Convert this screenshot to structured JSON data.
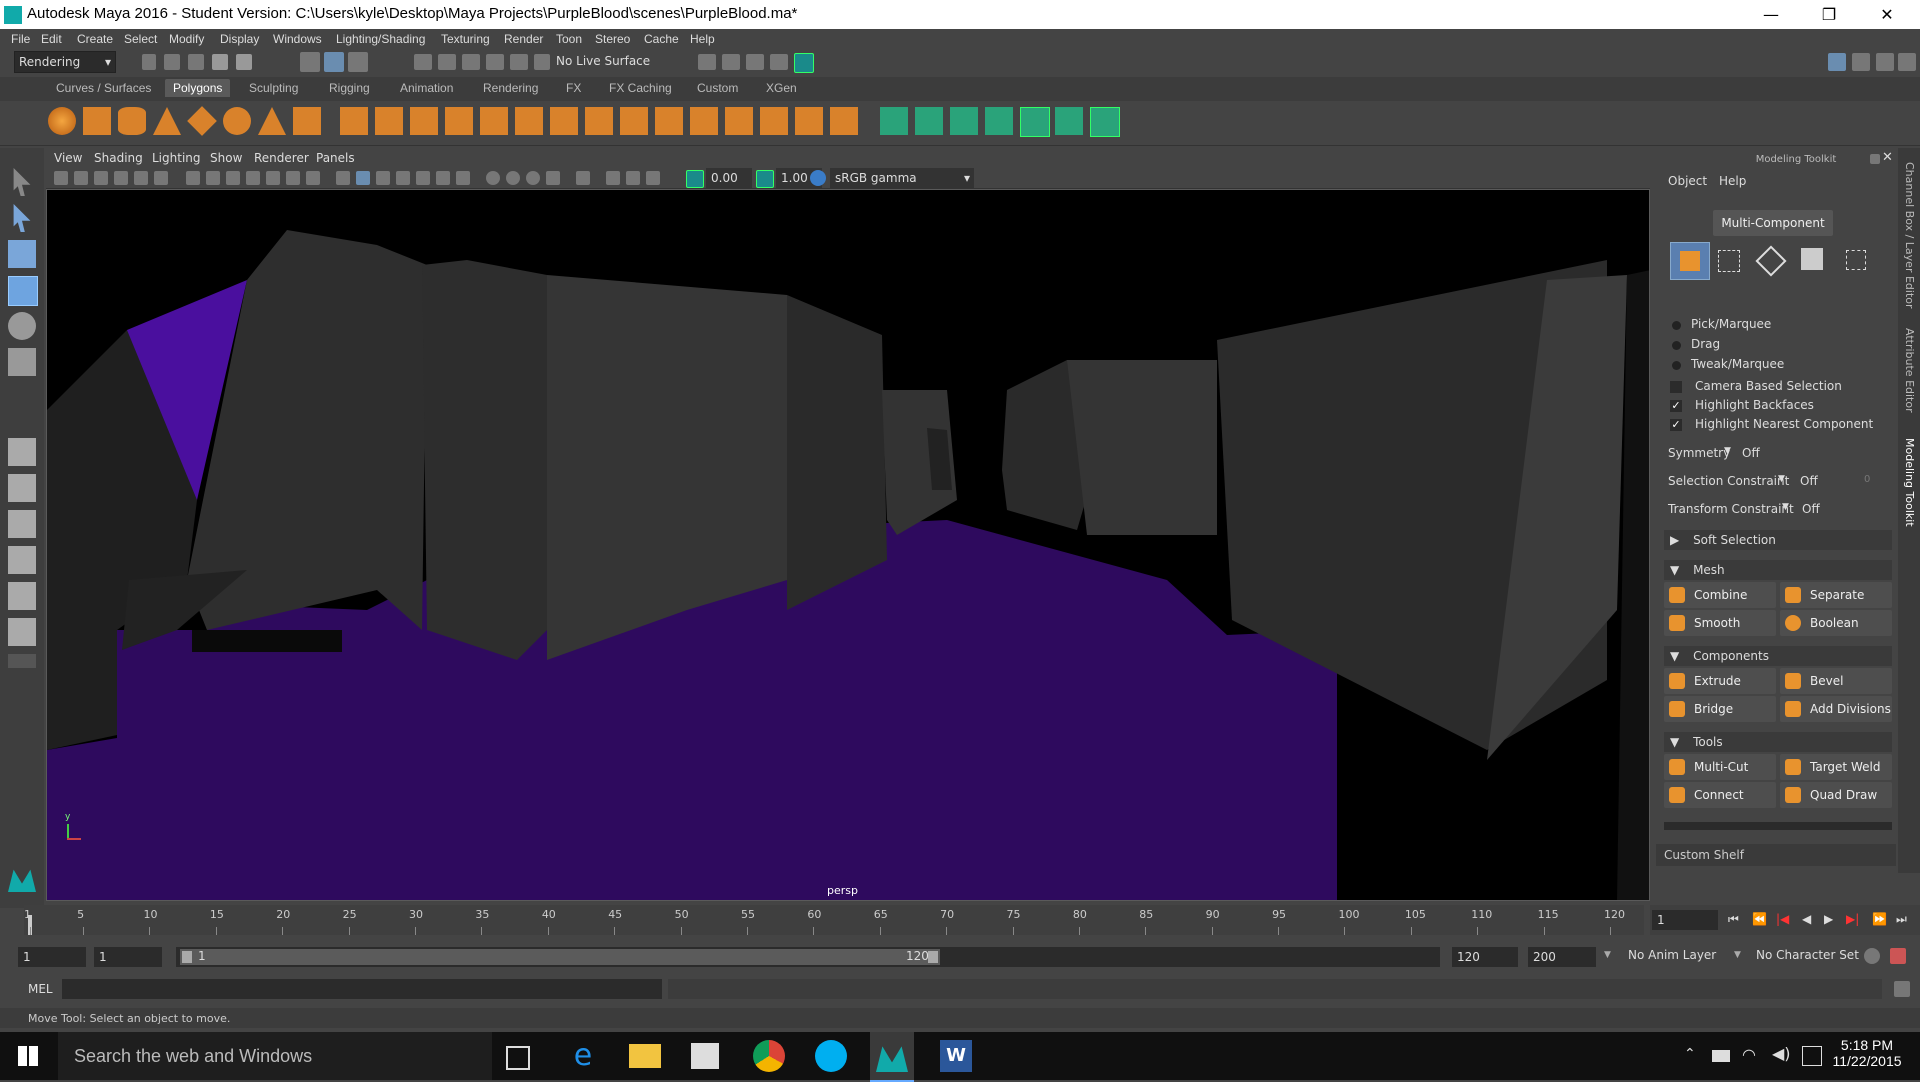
{
  "window": {
    "title": "Autodesk Maya 2016 - Student Version: C:\\Users\\kyle\\Desktop\\Maya Projects\\PurpleBlood\\scenes\\PurpleBlood.ma*",
    "minimize": "—",
    "restore": "❐",
    "close": "✕"
  },
  "menubar": [
    "File",
    "Edit",
    "Create",
    "Select",
    "Modify",
    "Display",
    "Windows",
    "Lighting/Shading",
    "Texturing",
    "Render",
    "Toon",
    "Stereo",
    "Cache",
    "Help"
  ],
  "statusline": {
    "menuset": "Rendering",
    "live_surface": "No Live Surface"
  },
  "shelf_tabs": [
    "Curves / Surfaces",
    "Polygons",
    "Sculpting",
    "Rigging",
    "Animation",
    "Rendering",
    "FX",
    "FX Caching",
    "Custom",
    "XGen"
  ],
  "shelf_active": "Polygons",
  "viewport": {
    "menu": [
      "View",
      "Shading",
      "Lighting",
      "Show",
      "Renderer",
      "Panels"
    ],
    "exposure": "0.00",
    "gamma": "1.00",
    "colorspace": "sRGB gamma",
    "camera_label": "persp",
    "axis_y": "y",
    "colors": {
      "purple": "#2e0a5e",
      "wall": "#2c2c2c",
      "dark": "#1a1a1a"
    }
  },
  "modeling_toolkit": {
    "title": "Modeling Toolkit",
    "menu": [
      "Object",
      "Help"
    ],
    "mode_button": "Multi-Component",
    "pick_marquee": "Pick/Marquee",
    "drag": "Drag",
    "tweak_marquee": "Tweak/Marquee",
    "camera_based": "Camera Based Selection",
    "highlight_backfaces": "Highlight Backfaces",
    "highlight_nearest": "Highlight Nearest Component",
    "symmetry_label": "Symmetry",
    "symmetry_value": "Off",
    "selection_constraint_label": "Selection Constraint",
    "selection_constraint_value": "Off",
    "selection_constraint_num": "0",
    "transform_constraint_label": "Transform Constraint",
    "transform_constraint_value": "Off",
    "soft_selection": "Soft Selection",
    "mesh": "Mesh",
    "combine": "Combine",
    "separate": "Separate",
    "smooth": "Smooth",
    "boolean": "Boolean",
    "components": "Components",
    "extrude": "Extrude",
    "bevel": "Bevel",
    "bridge": "Bridge",
    "add_divisions": "Add Divisions",
    "tools": "Tools",
    "multi_cut": "Multi-Cut",
    "target_weld": "Target Weld",
    "connect": "Connect",
    "quad_draw": "Quad Draw",
    "custom_shelf": "Custom Shelf"
  },
  "side_tabs": [
    "Channel Box / Layer Editor",
    "Attribute Editor",
    "Modeling Toolkit"
  ],
  "timeslider": {
    "ticks": [
      "1",
      "5",
      "10",
      "15",
      "20",
      "25",
      "30",
      "35",
      "40",
      "45",
      "50",
      "55",
      "60",
      "65",
      "70",
      "75",
      "80",
      "85",
      "90",
      "95",
      "100",
      "105",
      "110",
      "115",
      "120"
    ],
    "current_frame": "1"
  },
  "rangeslider": {
    "start": "1",
    "anim_start": "1",
    "range_start_label": "1",
    "range_end_label": "120",
    "end": "120",
    "anim_end": "200",
    "anim_layer": "No Anim Layer",
    "character_set": "No Character Set"
  },
  "cmdline": {
    "mel": "MEL"
  },
  "helpline": "Move Tool: Select an object to move.",
  "taskbar": {
    "search": "Search the web and Windows",
    "time": "5:18 PM",
    "date": "11/22/2015"
  }
}
